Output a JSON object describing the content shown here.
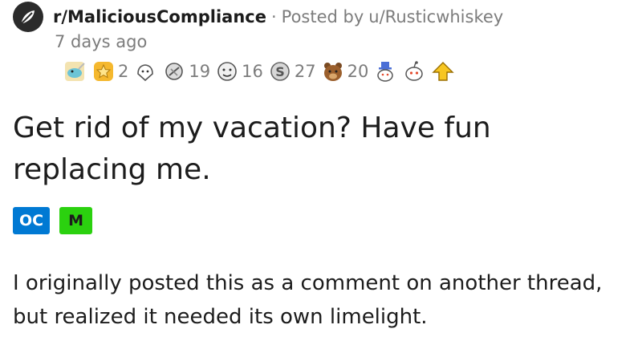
{
  "post": {
    "subreddit": "r/MaliciousCompliance",
    "separator": "·",
    "posted_by_prefix": "Posted by",
    "author": "u/Rusticwhiskey",
    "time": "7 days ago",
    "title": "Get rid of my vacation? Have fun replacing me.",
    "flairs": {
      "oc": "OC",
      "m": "M"
    },
    "body": "I originally posted this as a comment on another thread, but realized it needed its own limelight."
  },
  "awards": [
    {
      "icon": "narwhal-award-icon",
      "count": ""
    },
    {
      "icon": "star-award-icon",
      "count": "2"
    },
    {
      "icon": "helpful-award-icon",
      "count": ""
    },
    {
      "icon": "wholesome-award-icon",
      "count": "19"
    },
    {
      "icon": "bravo-award-icon",
      "count": "16"
    },
    {
      "icon": "silver-coin-award-icon",
      "count": "27"
    },
    {
      "icon": "bear-award-icon",
      "count": "20"
    },
    {
      "icon": "snoo-hat-award-icon",
      "count": ""
    },
    {
      "icon": "snoo-award-icon",
      "count": ""
    },
    {
      "icon": "upvote-award-icon",
      "count": ""
    }
  ],
  "colors": {
    "text": "#1c1c1c",
    "meta": "#7c7c7c",
    "oc_flair": "#0079d3",
    "m_flair": "#2bd10f"
  }
}
